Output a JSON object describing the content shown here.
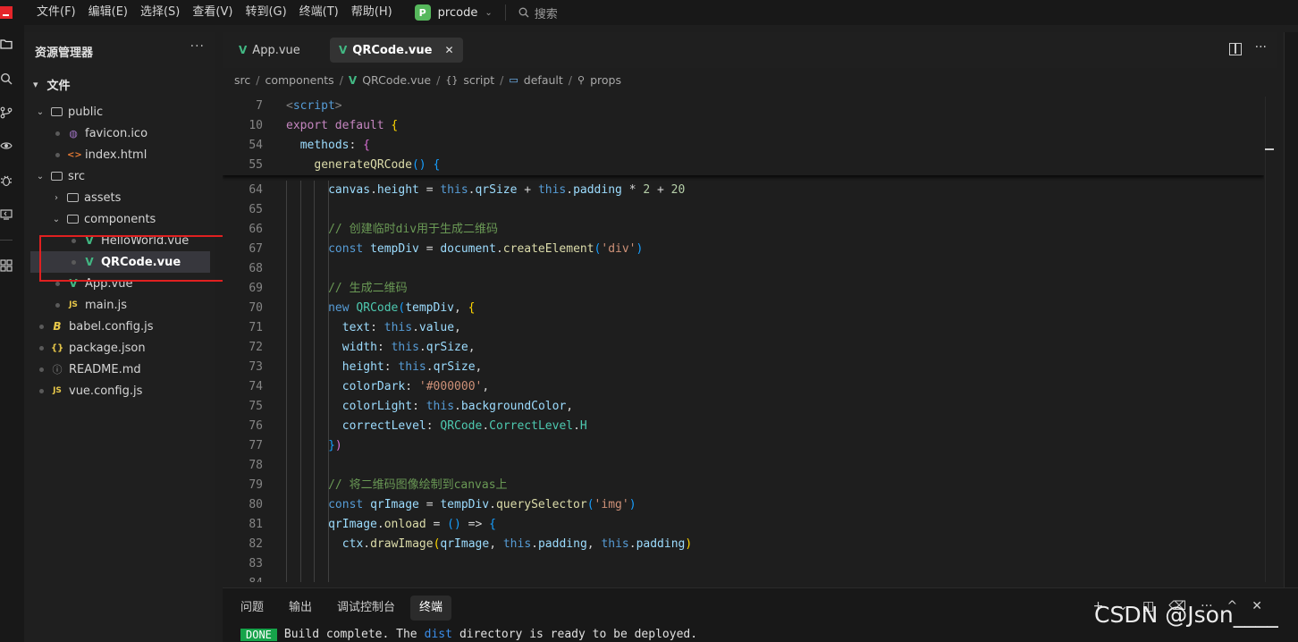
{
  "menubar": {
    "items": [
      "文件(F)",
      "编辑(E)",
      "选择(S)",
      "查看(V)",
      "转到(G)",
      "终端(T)",
      "帮助(H)"
    ],
    "project_badge": "P",
    "project_name": "prcode",
    "search_label": "搜索"
  },
  "explorer": {
    "title": "资源管理器",
    "section": "文件",
    "tree": [
      {
        "label": "public",
        "type": "folder",
        "expanded": true
      },
      {
        "label": "favicon.ico",
        "type": "ico"
      },
      {
        "label": "index.html",
        "type": "html"
      },
      {
        "label": "src",
        "type": "folder",
        "expanded": true
      },
      {
        "label": "assets",
        "type": "folder",
        "expanded": false
      },
      {
        "label": "components",
        "type": "folder",
        "expanded": true
      },
      {
        "label": "HelloWorld.vue",
        "type": "vue"
      },
      {
        "label": "QRCode.vue",
        "type": "vue",
        "selected": true
      },
      {
        "label": "App.vue",
        "type": "vue"
      },
      {
        "label": "main.js",
        "type": "js"
      },
      {
        "label": "babel.config.js",
        "type": "babel"
      },
      {
        "label": "package.json",
        "type": "json"
      },
      {
        "label": "README.md",
        "type": "info"
      },
      {
        "label": "vue.config.js",
        "type": "js"
      }
    ]
  },
  "editor": {
    "tabs": [
      {
        "label": "App.vue",
        "active": false
      },
      {
        "label": "QRCode.vue",
        "active": true
      }
    ],
    "breadcrumb": [
      "src",
      "components",
      "QRCode.vue",
      "script",
      "default",
      "props"
    ],
    "sticky_lines": [
      {
        "num": "7",
        "text": "<script>"
      },
      {
        "num": "10",
        "text": "export default {"
      },
      {
        "num": "54",
        "text": "methods: {"
      },
      {
        "num": "55",
        "text": "generateQRCode() {"
      }
    ],
    "lines": [
      {
        "num": "64",
        "text": "canvas.height = this.qrSize + this.padding * 2 + 20"
      },
      {
        "num": "65",
        "text": ""
      },
      {
        "num": "66",
        "text": "// 创建临时div用于生成二维码"
      },
      {
        "num": "67",
        "text": "const tempDiv = document.createElement('div')"
      },
      {
        "num": "68",
        "text": ""
      },
      {
        "num": "69",
        "text": "// 生成二维码"
      },
      {
        "num": "70",
        "text": "new QRCode(tempDiv, {"
      },
      {
        "num": "71",
        "text": "text: this.value,"
      },
      {
        "num": "72",
        "text": "width: this.qrSize,"
      },
      {
        "num": "73",
        "text": "height: this.qrSize,"
      },
      {
        "num": "74",
        "text": "colorDark: '#000000',"
      },
      {
        "num": "75",
        "text": "colorLight: this.backgroundColor,"
      },
      {
        "num": "76",
        "text": "correctLevel: QRCode.CorrectLevel.H"
      },
      {
        "num": "77",
        "text": "})"
      },
      {
        "num": "78",
        "text": ""
      },
      {
        "num": "79",
        "text": "// 将二维码图像绘制到canvas上"
      },
      {
        "num": "80",
        "text": "const qrImage = tempDiv.querySelector('img')"
      },
      {
        "num": "81",
        "text": "qrImage.onload = () => {"
      },
      {
        "num": "82",
        "text": "ctx.drawImage(qrImage, this.padding, this.padding)"
      },
      {
        "num": "83",
        "text": ""
      }
    ]
  },
  "panel": {
    "tabs": [
      "问题",
      "输出",
      "调试控制台",
      "终端"
    ],
    "active_tab": "终端",
    "terminal": {
      "badge": "DONE",
      "text_before": "Build complete. The",
      "highlight": "dist",
      "text_after": "directory is ready to be deployed."
    },
    "watermark": "CSDN @Json____"
  },
  "colors": {
    "accent_vue": "#42b883",
    "done_badge": "#16a34a",
    "highlight_box": "#e02020"
  }
}
